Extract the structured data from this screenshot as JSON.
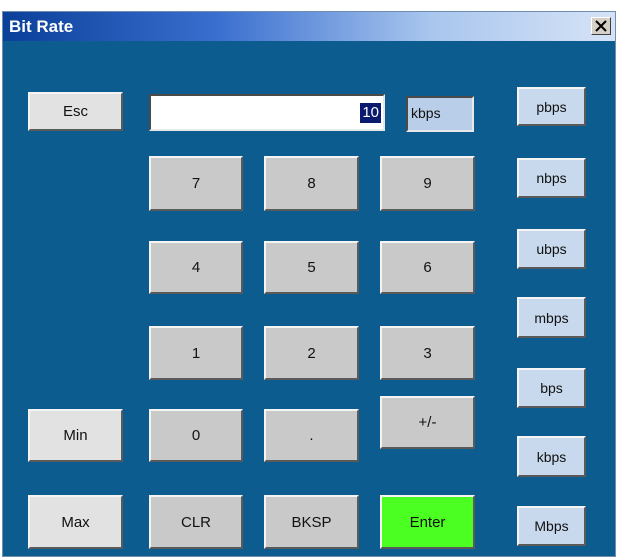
{
  "window": {
    "title": "Bit Rate",
    "close_label": "close"
  },
  "display": {
    "value": "10",
    "unit": "kbps"
  },
  "buttons": {
    "esc": "Esc",
    "min": "Min",
    "max": "Max",
    "k7": "7",
    "k8": "8",
    "k9": "9",
    "k4": "4",
    "k5": "5",
    "k6": "6",
    "k1": "1",
    "k2": "2",
    "k3": "3",
    "k0": "0",
    "dot": ".",
    "sign": "+/-",
    "clr": "CLR",
    "bksp": "BKSP",
    "enter": "Enter"
  },
  "units": [
    "pbps",
    "nbps",
    "ubps",
    "mbps",
    "bps",
    "kbps",
    "Mbps"
  ],
  "colors": {
    "background": "#0d5c8f",
    "enter": "#4cff22",
    "unit_button": "#c8d9ee"
  }
}
